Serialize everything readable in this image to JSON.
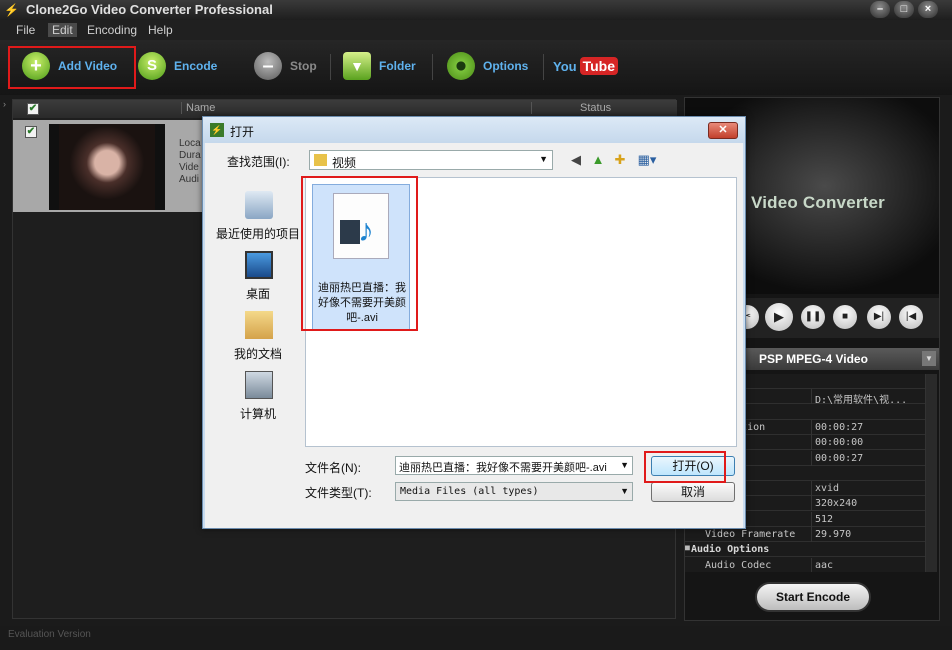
{
  "app": {
    "title": "Clone2Go Video Converter Professional",
    "window_buttons": [
      "–",
      "□",
      "×"
    ]
  },
  "menu": [
    "File",
    "Edit",
    "Encoding",
    "Help"
  ],
  "toolbar": {
    "add_video": "Add Video",
    "encode": "Encode",
    "stop": "Stop",
    "folder": "Folder",
    "options": "Options",
    "youtube_you": "You",
    "youtube_tube": "Tube"
  },
  "list": {
    "headers": {
      "check": "✔",
      "name": "Name",
      "status": "Status"
    },
    "row": {
      "meta": [
        "Loca",
        "Dura",
        "Vide",
        "Audi"
      ]
    }
  },
  "preview": {
    "title": "Video Converter"
  },
  "profile": {
    "label": "PSP MPEG-4 Video"
  },
  "properties": [
    {
      "k": "l",
      "v": "",
      "section": true
    },
    {
      "k": "ne",
      "v": "D:\\常用软件\\视..."
    },
    {
      "k": " Duration",
      "v": "",
      "section": true
    },
    {
      "k": "p duration",
      "v": "00:00:27"
    },
    {
      "k": "ime",
      "v": "00:00:00"
    },
    {
      "k": "ne",
      "v": "00:00:27"
    },
    {
      "k": " Options",
      "v": "",
      "section": true
    },
    {
      "k": "odec",
      "v": "xvid"
    },
    {
      "k": "ize",
      "v": "320x240"
    },
    {
      "k": "itrate",
      "v": "512"
    },
    {
      "k": "Video Framerate",
      "v": "29.970"
    },
    {
      "k": "Audio Options",
      "v": "",
      "section": true
    },
    {
      "k": "Audio Codec",
      "v": "aac"
    }
  ],
  "start_encode": "Start Encode",
  "status": "Evaluation Version",
  "dialog": {
    "title": "打开",
    "look_in_label": "查找范围(I):",
    "look_in_value": "视频",
    "places": [
      "最近使用的项目",
      "桌面",
      "我的文档",
      "计算机"
    ],
    "file": {
      "name": "迪丽热巴直播：我好像不需要开美颜吧-.avi"
    },
    "filename_label": "文件名(N):",
    "filename_value": "迪丽热巴直播：我好像不需要开美颜吧-.avi",
    "filetype_label": "文件类型(T):",
    "filetype_value": "Media Files (all types)",
    "open_button": "打开(O)",
    "cancel_button": "取消"
  }
}
